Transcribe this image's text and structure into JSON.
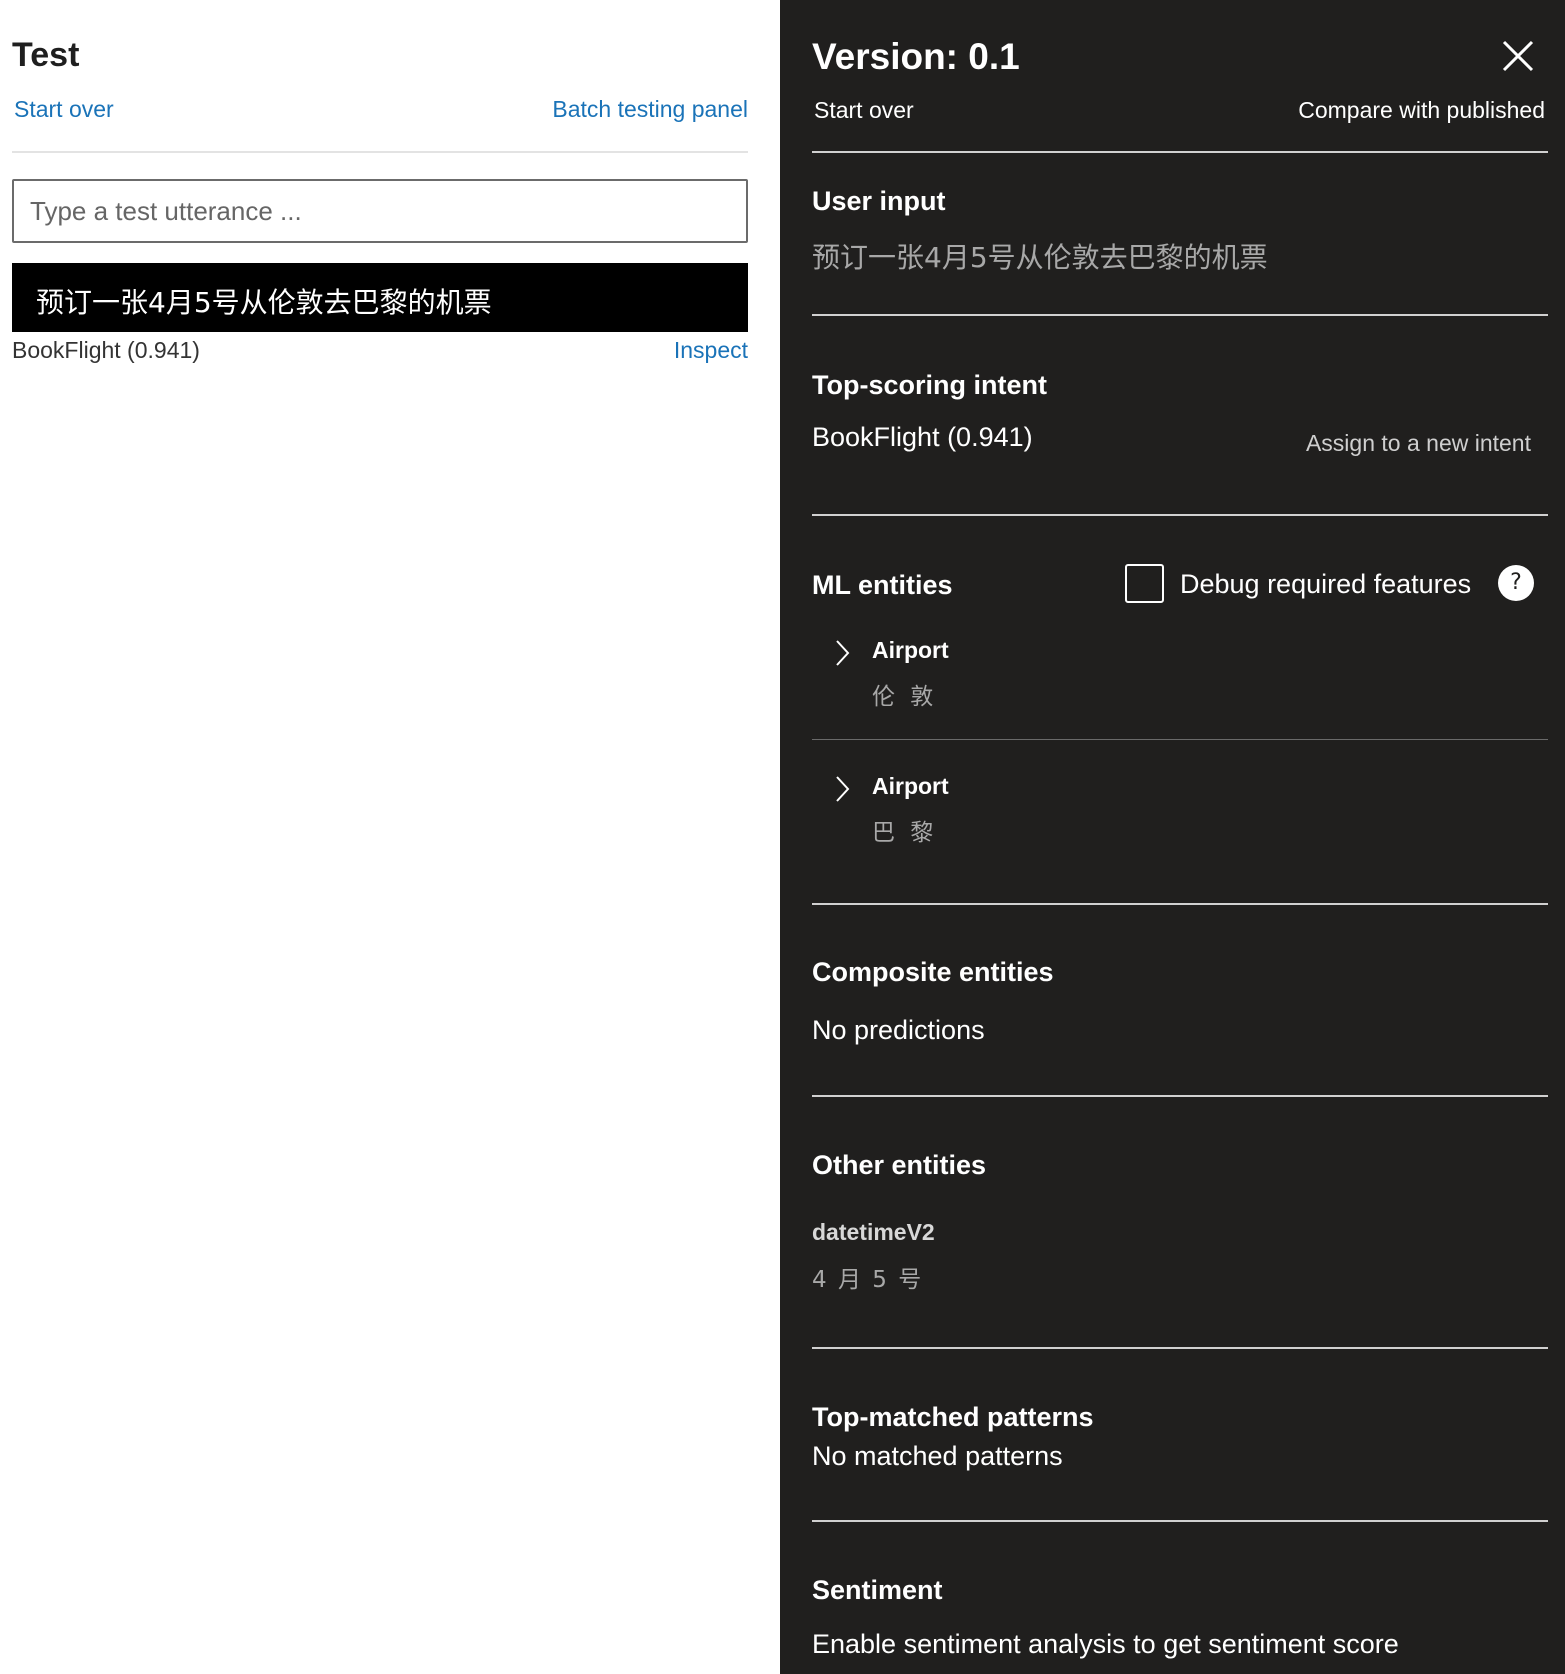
{
  "test_panel": {
    "title": "Test",
    "start_over": "Start over",
    "batch_testing": "Batch testing panel",
    "input_placeholder": "Type a test utterance ...",
    "utterance": "预订一张4月5号从伦敦去巴黎的机票",
    "result_intent": "BookFlight (0.941)",
    "inspect": "Inspect"
  },
  "inspect_panel": {
    "version_title": "Version: 0.1",
    "start_over": "Start over",
    "compare": "Compare with published",
    "user_input": {
      "heading": "User input",
      "value": "预订一张4月5号从伦敦去巴黎的机票"
    },
    "top_intent": {
      "heading": "Top-scoring intent",
      "value": "BookFlight (0.941)",
      "assign_link": "Assign to a new intent"
    },
    "ml_entities": {
      "heading": "ML entities",
      "debug_label": "Debug required features",
      "debug_checked": false,
      "help_icon": "?",
      "items": [
        {
          "name": "Airport",
          "value": "伦 敦"
        },
        {
          "name": "Airport",
          "value": "巴 黎"
        }
      ]
    },
    "composite_entities": {
      "heading": "Composite entities",
      "value": "No predictions"
    },
    "other_entities": {
      "heading": "Other entities",
      "items": [
        {
          "name": "datetimeV2",
          "value": "4 月 5 号"
        }
      ]
    },
    "patterns": {
      "heading": "Top-matched patterns",
      "value": "No matched patterns"
    },
    "sentiment": {
      "heading": "Sentiment",
      "value": "Enable sentiment analysis to get sentiment score"
    }
  },
  "colors": {
    "link_blue": "#1a73b8",
    "dark_panel": "#201f1e",
    "secondary_text": "#a8a8a8"
  }
}
